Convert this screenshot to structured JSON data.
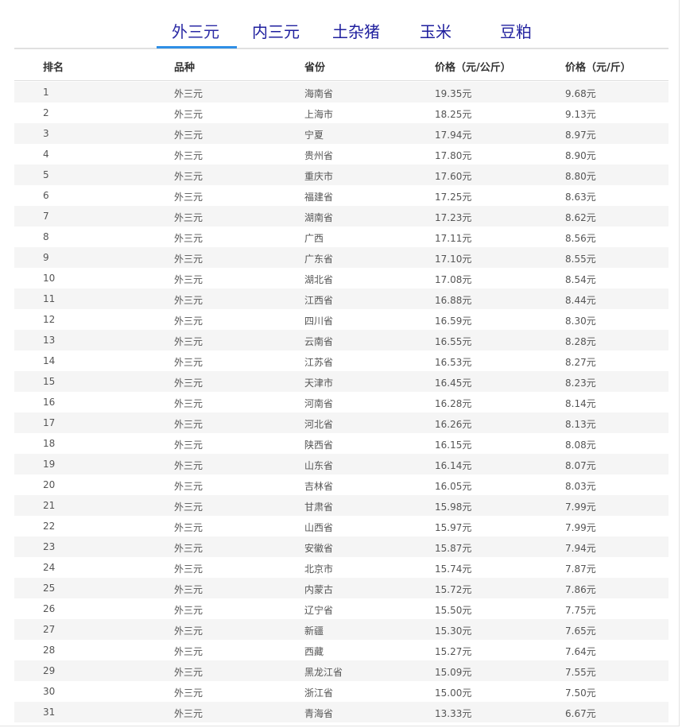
{
  "tabs": [
    {
      "label": "外三元",
      "active": true
    },
    {
      "label": "内三元",
      "active": false
    },
    {
      "label": "土杂猪",
      "active": false
    },
    {
      "label": "玉米",
      "active": false
    },
    {
      "label": "豆粕",
      "active": false
    }
  ],
  "colors": {
    "tab_text": "#1f1f9e",
    "active_underline": "#2f8fe6",
    "stripe": "#f5f5f5"
  },
  "table": {
    "headers": [
      "排名",
      "品种",
      "省份",
      "价格（元/公斤）",
      "价格（元/斤）"
    ],
    "rows": [
      [
        "1",
        "外三元",
        "海南省",
        "19.35元",
        "9.68元"
      ],
      [
        "2",
        "外三元",
        "上海市",
        "18.25元",
        "9.13元"
      ],
      [
        "3",
        "外三元",
        "宁夏",
        "17.94元",
        "8.97元"
      ],
      [
        "4",
        "外三元",
        "贵州省",
        "17.80元",
        "8.90元"
      ],
      [
        "5",
        "外三元",
        "重庆市",
        "17.60元",
        "8.80元"
      ],
      [
        "6",
        "外三元",
        "福建省",
        "17.25元",
        "8.63元"
      ],
      [
        "7",
        "外三元",
        "湖南省",
        "17.23元",
        "8.62元"
      ],
      [
        "8",
        "外三元",
        "广西",
        "17.11元",
        "8.56元"
      ],
      [
        "9",
        "外三元",
        "广东省",
        "17.10元",
        "8.55元"
      ],
      [
        "10",
        "外三元",
        "湖北省",
        "17.08元",
        "8.54元"
      ],
      [
        "11",
        "外三元",
        "江西省",
        "16.88元",
        "8.44元"
      ],
      [
        "12",
        "外三元",
        "四川省",
        "16.59元",
        "8.30元"
      ],
      [
        "13",
        "外三元",
        "云南省",
        "16.55元",
        "8.28元"
      ],
      [
        "14",
        "外三元",
        "江苏省",
        "16.53元",
        "8.27元"
      ],
      [
        "15",
        "外三元",
        "天津市",
        "16.45元",
        "8.23元"
      ],
      [
        "16",
        "外三元",
        "河南省",
        "16.28元",
        "8.14元"
      ],
      [
        "17",
        "外三元",
        "河北省",
        "16.26元",
        "8.13元"
      ],
      [
        "18",
        "外三元",
        "陕西省",
        "16.15元",
        "8.08元"
      ],
      [
        "19",
        "外三元",
        "山东省",
        "16.14元",
        "8.07元"
      ],
      [
        "20",
        "外三元",
        "吉林省",
        "16.05元",
        "8.03元"
      ],
      [
        "21",
        "外三元",
        "甘肃省",
        "15.98元",
        "7.99元"
      ],
      [
        "22",
        "外三元",
        "山西省",
        "15.97元",
        "7.99元"
      ],
      [
        "23",
        "外三元",
        "安徽省",
        "15.87元",
        "7.94元"
      ],
      [
        "24",
        "外三元",
        "北京市",
        "15.74元",
        "7.87元"
      ],
      [
        "25",
        "外三元",
        "内蒙古",
        "15.72元",
        "7.86元"
      ],
      [
        "26",
        "外三元",
        "辽宁省",
        "15.50元",
        "7.75元"
      ],
      [
        "27",
        "外三元",
        "新疆",
        "15.30元",
        "7.65元"
      ],
      [
        "28",
        "外三元",
        "西藏",
        "15.27元",
        "7.64元"
      ],
      [
        "29",
        "外三元",
        "黑龙江省",
        "15.09元",
        "7.55元"
      ],
      [
        "30",
        "外三元",
        "浙江省",
        "15.00元",
        "7.50元"
      ],
      [
        "31",
        "外三元",
        "青海省",
        "13.33元",
        "6.67元"
      ]
    ]
  }
}
